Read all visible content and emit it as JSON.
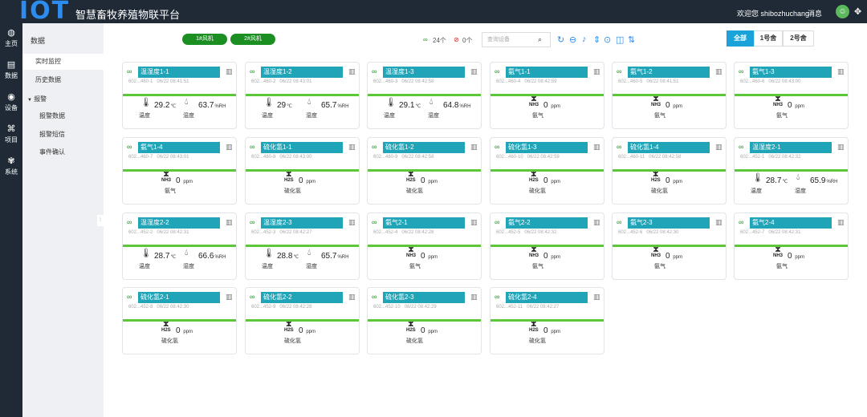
{
  "header": {
    "logo": "IOT",
    "title": "智慧畜牧养殖物联平台",
    "welcome": "欢迎您 shibozhuchang",
    "messages": "消息",
    "avatar_icon": "user-icon",
    "expand_icon": "fullscreen-icon"
  },
  "iconbar": [
    {
      "label": "主页",
      "icon": "globe-icon"
    },
    {
      "label": "数据",
      "icon": "database-icon"
    },
    {
      "label": "设备",
      "icon": "eye-icon"
    },
    {
      "label": "项目",
      "icon": "project-icon"
    },
    {
      "label": "系统",
      "icon": "settings-icon"
    }
  ],
  "sidemenu": {
    "section": "数据",
    "items": [
      "实时监控",
      "历史数据",
      "报警",
      "报警数据",
      "报警短信",
      "事件确认"
    ]
  },
  "filters": {
    "fans": [
      "1#风机",
      "2#风机"
    ],
    "online_count": "24个",
    "offline_count": "0个",
    "search_placeholder": "查询设备",
    "tabs": [
      "全部",
      "1号舍",
      "2号舍"
    ]
  },
  "cards": [
    {
      "name": "温湿度1-1",
      "id": "602...460-1",
      "time": "06/22 08:41:51",
      "kind": "th",
      "temp": "29.2",
      "hum": "63.7"
    },
    {
      "name": "温湿度1-2",
      "id": "602...460-2",
      "time": "06/22 08:43:01",
      "kind": "th",
      "temp": "29",
      "hum": "65.7"
    },
    {
      "name": "温湿度1-3",
      "id": "602...460-3",
      "time": "06/22 08:42:58",
      "kind": "th",
      "temp": "29.1",
      "hum": "64.8"
    },
    {
      "name": "氨气1-1",
      "id": "602...460-4",
      "time": "06/22 08:42:59",
      "kind": "nh3",
      "val": "0"
    },
    {
      "name": "氨气1-2",
      "id": "602...460-5",
      "time": "06/22 08:41:51",
      "kind": "nh3",
      "val": "0"
    },
    {
      "name": "氨气1-3",
      "id": "602...460-6",
      "time": "06/22 08:43:00",
      "kind": "nh3",
      "val": "0"
    },
    {
      "name": "氨气1-4",
      "id": "602...460-7",
      "time": "06/22 08:43:01",
      "kind": "nh3",
      "val": "0"
    },
    {
      "name": "硫化氢1-1",
      "id": "602...460-8",
      "time": "06/22 08:43:00",
      "kind": "h2s",
      "val": "0"
    },
    {
      "name": "硫化氢1-2",
      "id": "602...460-9",
      "time": "06/22 08:42:58",
      "kind": "h2s",
      "val": "0"
    },
    {
      "name": "硫化氢1-3",
      "id": "602...460-10",
      "time": "06/22 08:42:59",
      "kind": "h2s",
      "val": "0"
    },
    {
      "name": "硫化氢1-4",
      "id": "602...460-11",
      "time": "06/22 08:42:58",
      "kind": "h2s",
      "val": "0"
    },
    {
      "name": "温湿度2-1",
      "id": "602...452-1",
      "time": "06/22 08:42:32",
      "kind": "th",
      "temp": "28.7",
      "hum": "65.9"
    },
    {
      "name": "温湿度2-2",
      "id": "602...452-2",
      "time": "06/22 08:42:31",
      "kind": "th",
      "temp": "28.7",
      "hum": "66.6"
    },
    {
      "name": "温湿度2-3",
      "id": "602...452-3",
      "time": "06/22 08:42:27",
      "kind": "th",
      "temp": "28.8",
      "hum": "65.7"
    },
    {
      "name": "氨气2-1",
      "id": "602...452-4",
      "time": "06/22 08:42:28",
      "kind": "nh3",
      "val": "0"
    },
    {
      "name": "氨气2-2",
      "id": "602...452-5",
      "time": "06/22 08:42:32",
      "kind": "nh3",
      "val": "0"
    },
    {
      "name": "氨气2-3",
      "id": "602...452-6",
      "time": "06/22 08:42:30",
      "kind": "nh3",
      "val": "0"
    },
    {
      "name": "氨气2-4",
      "id": "602...452-7",
      "time": "06/22 08:42:31",
      "kind": "nh3",
      "val": "0"
    },
    {
      "name": "硫化氢2-1",
      "id": "602...452-8",
      "time": "06/22 08:42:30",
      "kind": "h2s",
      "val": "0"
    },
    {
      "name": "硫化氢2-2",
      "id": "602...452-9",
      "time": "06/22 08:42:28",
      "kind": "h2s",
      "val": "0"
    },
    {
      "name": "硫化氢2-3",
      "id": "602...452-10",
      "time": "06/22 08:42:29",
      "kind": "h2s",
      "val": "0"
    },
    {
      "name": "硫化氢2-4",
      "id": "602...452-11",
      "time": "06/22 08:42:27",
      "kind": "h2s",
      "val": "0"
    }
  ],
  "labels": {
    "temp": "温度",
    "hum": "湿度",
    "nh3": "氨气",
    "h2s": "硫化氢",
    "temp_unit": "℃",
    "hum_unit": "%RH",
    "ppm": "ppm",
    "nh3_symbol": "NH3",
    "h2s_symbol": "H2S"
  },
  "colors": {
    "accent": "#20a4b8",
    "green": "#1c8f22",
    "bar": "#5cc739",
    "dark": "#1f2a36"
  }
}
